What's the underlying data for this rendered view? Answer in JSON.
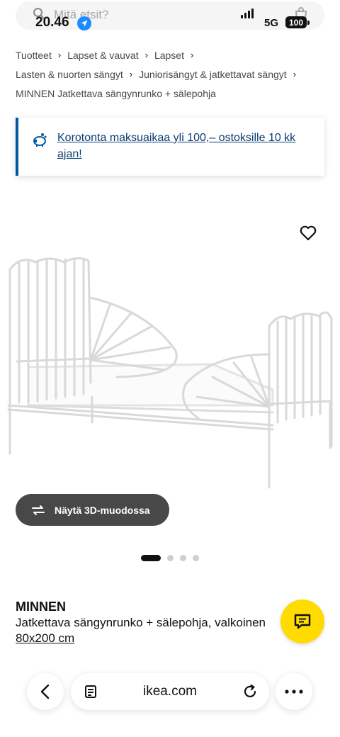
{
  "status_bar": {
    "time": "20.46",
    "network": "5G",
    "battery": "100"
  },
  "search": {
    "placeholder": "Mitä etsit?"
  },
  "breadcrumb": {
    "line1": [
      "Tuotteet",
      "Lapset & vauvat",
      "Lapset"
    ],
    "line2": [
      "Lasten & nuorten sängyt",
      "Juniorisängyt & jatkettavat sängyt"
    ],
    "current": "MINNEN Jatkettava sängynrunko + sälepohja"
  },
  "promo": {
    "text": "Korotonta maksuaikaa yli 100,– ostoksille 10 kk ajan!",
    "accent": "#0058a3"
  },
  "gallery": {
    "view3d_label": "Näytä 3D-muodossa",
    "dot_count": 4,
    "active_index": 0
  },
  "product": {
    "name": "MINNEN",
    "description": "Jatkettava sängynrunko + sälepohja, valkoinen",
    "size": "80x200 cm"
  },
  "browser": {
    "url": "ikea.com"
  },
  "colors": {
    "chat_button": "#ffdb00",
    "view3d_button": "#484848",
    "promo_text": "#0d3c72"
  },
  "icons": {
    "search": "search-icon",
    "location": "location-arrow-icon",
    "bag": "shopping-bag-icon",
    "promo": "piggy-bank-icon",
    "favourite": "heart-icon",
    "rotate3d": "rotate-3d-icon",
    "chat": "chat-icon",
    "back": "chevron-left-icon",
    "reader": "reader-icon",
    "reload": "reload-icon",
    "more": "more-icon"
  }
}
